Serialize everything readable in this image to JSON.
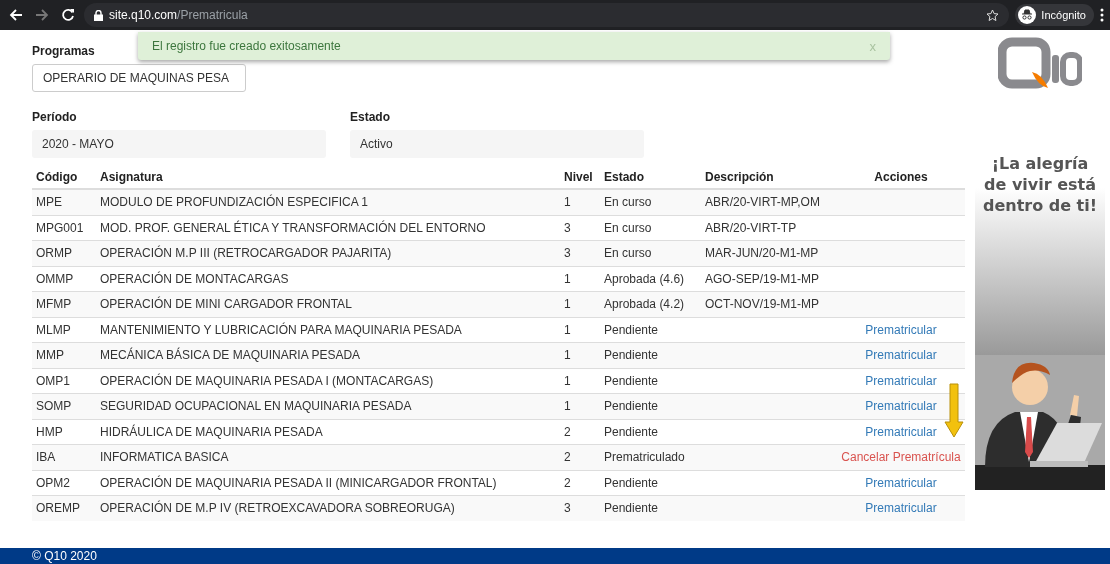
{
  "browser": {
    "url_host": "site.q10.com",
    "url_path": "/Prematricula",
    "profile": "Incógnito"
  },
  "alert": {
    "message": "El registro fue creado exitosamente",
    "close": "x"
  },
  "programs": {
    "label": "Programas",
    "value": "OPERARIO DE MAQUINAS PESA"
  },
  "fields": [
    {
      "label": "Período",
      "value": "2020 - MAYO"
    },
    {
      "label": "Estado",
      "value": "Activo"
    }
  ],
  "table": {
    "columns": [
      "Código",
      "Asignatura",
      "Nivel",
      "Estado",
      "Descripción",
      "Acciones"
    ],
    "rows": [
      {
        "code": "MPE",
        "subject": "MODULO DE PROFUNDIZACIÓN ESPECIFICA 1",
        "level": "1",
        "status": "En curso",
        "description": "ABR/20-VIRT-MP,OM"
      },
      {
        "code": "MPG001",
        "subject": "MOD. PROF. GENERAL ÉTICA Y TRANSFORMACIÓN DEL ENTORNO",
        "level": "3",
        "status": "En curso",
        "description": "ABR/20-VIRT-TP"
      },
      {
        "code": "ORMP",
        "subject": "OPERACIÓN M.P III (RETROCARGADOR PAJARITA)",
        "level": "3",
        "status": "En curso",
        "description": "MAR-JUN/20-M1-MP"
      },
      {
        "code": "OMMP",
        "subject": "OPERACIÓN DE MONTACARGAS",
        "level": "1",
        "status": "Aprobada (4.6)",
        "description": "AGO-SEP/19-M1-MP"
      },
      {
        "code": "MFMP",
        "subject": "OPERACIÓN DE MINI CARGADOR FRONTAL",
        "level": "1",
        "status": "Aprobada (4.2)",
        "description": "OCT-NOV/19-M1-MP"
      },
      {
        "code": "MLMP",
        "subject": "MANTENIMIENTO Y LUBRICACIÓN PARA MAQUINARIA PESADA",
        "level": "1",
        "status": "Pendiente",
        "action": {
          "kind": "enroll",
          "label": "Prematricular"
        }
      },
      {
        "code": "MMP",
        "subject": "MECÁNICA BÁSICA DE MAQUINARIA PESADA",
        "level": "1",
        "status": "Pendiente",
        "action": {
          "kind": "enroll",
          "label": "Prematricular"
        }
      },
      {
        "code": "OMP1",
        "subject": "OPERACIÓN DE MAQUINARIA PESADA I (MONTACARGAS)",
        "level": "1",
        "status": "Pendiente",
        "action": {
          "kind": "enroll",
          "label": "Prematricular"
        }
      },
      {
        "code": "SOMP",
        "subject": "SEGURIDAD OCUPACIONAL EN MAQUINARIA PESADA",
        "level": "1",
        "status": "Pendiente",
        "action": {
          "kind": "enroll",
          "label": "Prematricular"
        }
      },
      {
        "code": "HMP",
        "subject": "HIDRÁULICA DE MAQUINARIA PESADA",
        "level": "2",
        "status": "Pendiente",
        "action": {
          "kind": "enroll",
          "label": "Prematricular"
        }
      },
      {
        "code": "IBA",
        "subject": "INFORMATICA BASICA",
        "level": "2",
        "status": "Prematriculado",
        "action": {
          "kind": "cancel",
          "label": "Cancelar Prematrícula"
        }
      },
      {
        "code": "OPM2",
        "subject": "OPERACIÓN DE MAQUINARIA PESADA II (MINICARGADOR FRONTAL)",
        "level": "2",
        "status": "Pendiente",
        "action": {
          "kind": "enroll",
          "label": "Prematricular"
        }
      },
      {
        "code": "OREMP",
        "subject": "OPERACIÓN DE M.P IV (RETROEXCAVADORA SOBREORUGA)",
        "level": "3",
        "status": "Pendiente",
        "action": {
          "kind": "enroll",
          "label": "Prematricular"
        }
      }
    ]
  },
  "ad": {
    "slogan": "¡La alegría de vivir está dentro de ti!",
    "kind": "picture"
  },
  "footer": "© Q10 2020"
}
